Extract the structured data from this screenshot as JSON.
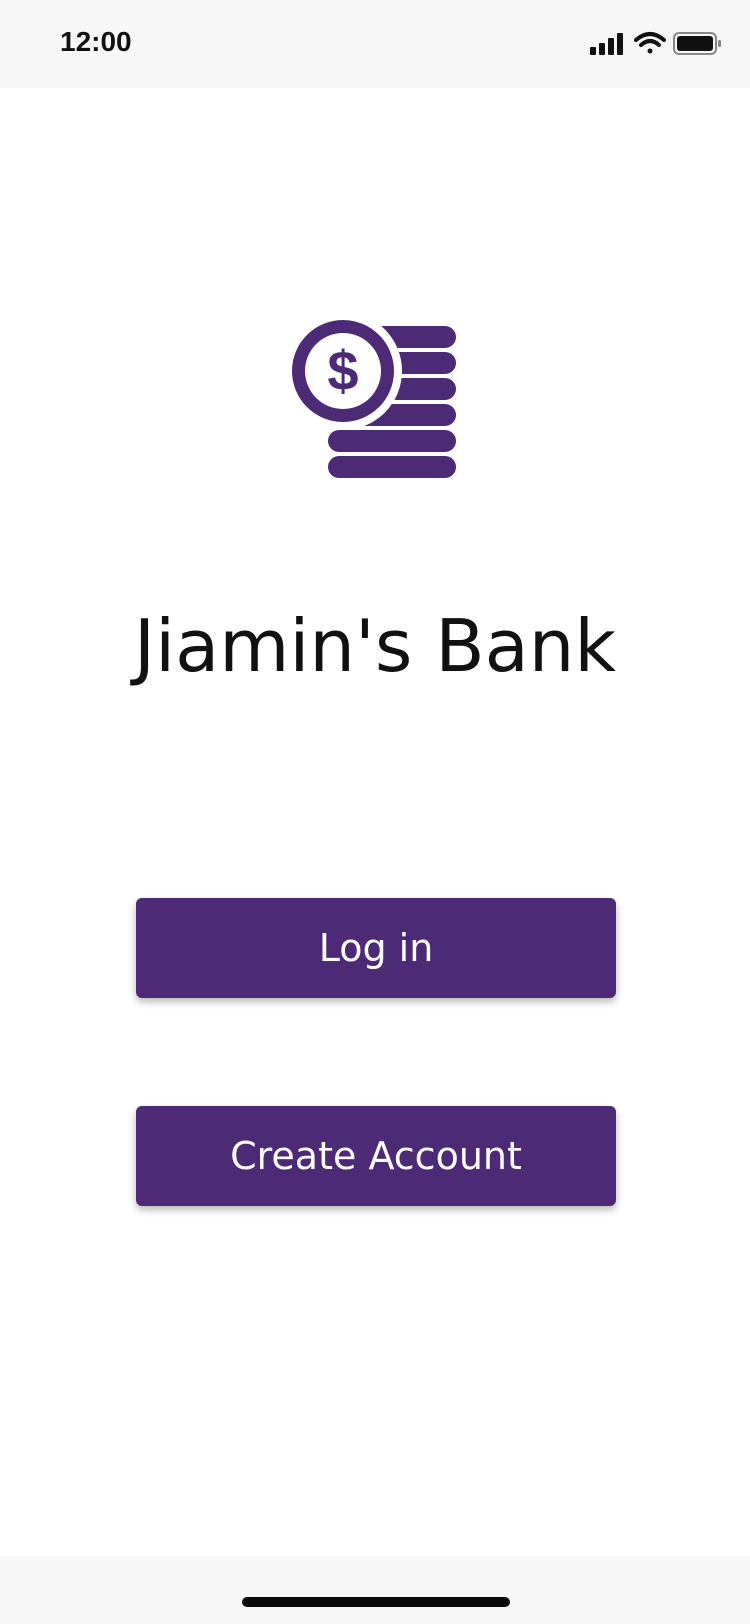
{
  "status_bar": {
    "time": "12:00",
    "signal_icon": "cellular-signal-icon",
    "wifi_icon": "wifi-icon",
    "battery_icon": "battery-icon"
  },
  "logo": {
    "icon": "coin-stack-dollar-icon",
    "color": "#4c2a76"
  },
  "app": {
    "title": "Jiamin's Bank"
  },
  "buttons": {
    "login_label": "Log in",
    "create_account_label": "Create Account",
    "color": "#4c2a76"
  }
}
